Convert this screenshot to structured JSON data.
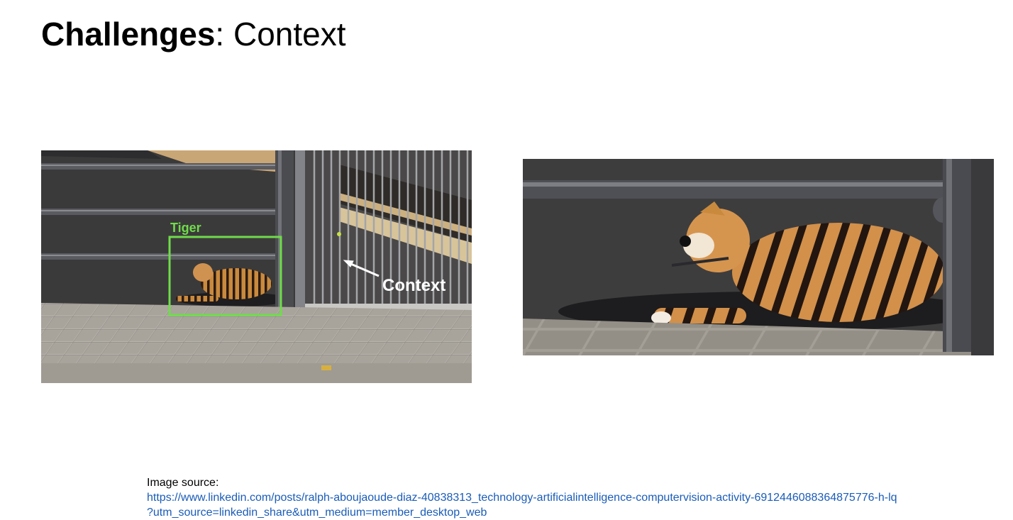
{
  "slide": {
    "title_bold": "Challenges",
    "title_rest": ": Context"
  },
  "left_image": {
    "box_label": "Tiger",
    "box_color": "#6fdc4a",
    "arrow_label": "Context",
    "arrow_color": "#ffffff"
  },
  "right_image": {},
  "source": {
    "label": "Image source:",
    "url_line1": "https://www.linkedin.com/posts/ralph-aboujaoude-diaz-40838313_technology-artificialintelligence-computervision-activity-6912446088364875776-h-lq",
    "url_line2": "?utm_source=linkedin_share&utm_medium=member_desktop_web",
    "link_color": "#1a5cb8"
  }
}
